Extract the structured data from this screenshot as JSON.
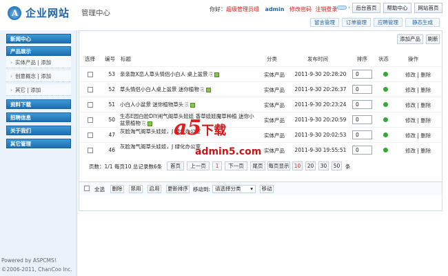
{
  "brand": {
    "title": "企业网站",
    "subtitle": "管理中心"
  },
  "user_line": {
    "hello": "你好：",
    "role": "超级管理员组",
    "username": "admin",
    "change_pwd": "修改密码",
    "logout": "注销登录"
  },
  "top_buttons": [
    "后台首页",
    "帮助中心",
    "网站首页"
  ],
  "subnav": [
    "留言管理",
    "订单管理",
    "应聘管理",
    "静态生成"
  ],
  "sidebar": {
    "sections": [
      "新闻中心",
      "产品展示",
      "资料下载",
      "招聘信息",
      "关于我们",
      "其它管理"
    ],
    "subitems": [
      "实体产品 | 添加",
      "创意概念 | 添加",
      "其它 | 添加"
    ]
  },
  "footer": {
    "powered": "Powered by ASPCMS!",
    "copyright": "©2006-2011, ChanCoo Inc."
  },
  "toolbar": {
    "add": "添加产品",
    "refresh": "刷新"
  },
  "table": {
    "headers": [
      "选择",
      "编号",
      "标题",
      "分类",
      "发布时间",
      "排序",
      "状态",
      "操作"
    ],
    "rows": [
      {
        "id": "53",
        "title": "亲亲款X恋人草头情侣小白人 桌上盆景",
        "category": "实体产品",
        "time": "2011-9-30 20:28:20",
        "sort": "0",
        "ops": "修改 | 删除"
      },
      {
        "id": "52",
        "title": "草头情侣小白人桌上盆景 迷你植物",
        "category": "实体产品",
        "time": "2011-9-30 20:26:37",
        "sort": "0",
        "ops": "修改 | 删除"
      },
      {
        "id": "51",
        "title": "小白人小盆景 迷你植物草头",
        "category": "实体产品",
        "time": "2011-9-30 20:23:24",
        "sort": "0",
        "ops": "修改 | 删除"
      },
      {
        "id": "50",
        "title": "生态E园白脸DIY闹气阁草头娃娃 香草娃娃魔草种植 迷你小盆景植物",
        "category": "实体产品",
        "time": "2011-9-30 20:20:59",
        "sort": "0",
        "ops": "修改 | 删除"
      },
      {
        "id": "47",
        "title": "灰脸淘气阁草头娃娃，J 绿化办公室",
        "category": "实体产品",
        "time": "2011-9-30 20:02:53",
        "sort": "0",
        "ops": "修改 | 删除"
      },
      {
        "id": "46",
        "title": "灰脸淘气阁草头娃娃，J 绿化办公室",
        "category": "实体产品",
        "time": "2011-9-30 19:55:51",
        "sort": "0",
        "ops": "修改 | 删除"
      }
    ]
  },
  "pagination": {
    "summary": "页数：1/1 每页10 总记录数6条",
    "first": "首页",
    "prev": "上一页",
    "current": "1",
    "next": "下一页",
    "last": "尾页",
    "per_page_label": "每页显示",
    "sizes": [
      "10",
      "20",
      "30",
      "50"
    ],
    "unit": "条"
  },
  "bulk": {
    "select_all": "全选",
    "delete": "删除",
    "disable": "禁用",
    "enable": "启用",
    "update_sort": "更新排序",
    "move_to": "移动到:",
    "select_placeholder": "请选择分类",
    "move": "移动"
  },
  "watermark": {
    "logo": "a5",
    "label": "下载",
    "url": "admin5.com"
  },
  "colors": {
    "accent": "#1d64a8",
    "danger": "#d2211a",
    "sidebar_header": "#1b6fb3",
    "status_ok": "#3aa63a"
  }
}
